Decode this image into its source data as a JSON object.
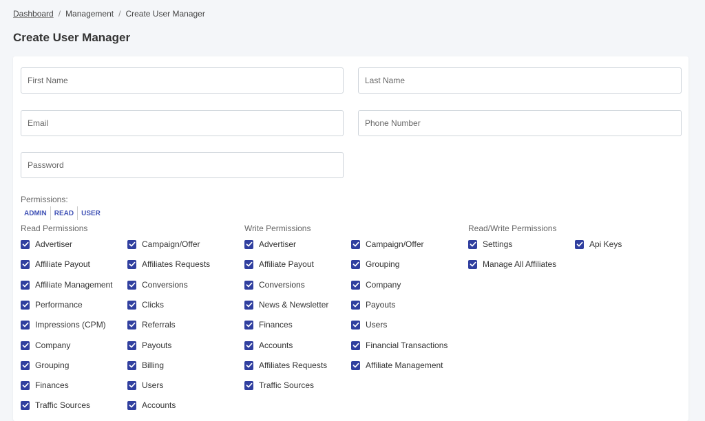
{
  "breadcrumb": {
    "items": [
      "Dashboard",
      "Management",
      "Create User Manager"
    ],
    "separator": "/"
  },
  "page_title": "Create User Manager",
  "form": {
    "first_name_placeholder": "First Name",
    "last_name_placeholder": "Last Name",
    "email_placeholder": "Email",
    "phone_placeholder": "Phone Number",
    "password_placeholder": "Password"
  },
  "permissions": {
    "label": "Permissions:",
    "roles": [
      "ADMIN",
      "READ",
      "USER"
    ],
    "accent_color": "#303f9f",
    "groups": [
      {
        "title": "Read Permissions",
        "columns": [
          [
            "Advertiser",
            "Affiliate Payout",
            "Affiliate Management",
            "Performance",
            "Impressions (CPM)",
            "Company",
            "Grouping",
            "Finances",
            "Traffic Sources"
          ],
          [
            "Campaign/Offer",
            "Affiliates Requests",
            "Conversions",
            "Clicks",
            "Referrals",
            "Payouts",
            "Billing",
            "Users",
            "Accounts"
          ]
        ]
      },
      {
        "title": "Write Permissions",
        "columns": [
          [
            "Advertiser",
            "Affiliate Payout",
            "Conversions",
            "News & Newsletter",
            "Finances",
            "Accounts",
            "Affiliates Requests",
            "Traffic Sources"
          ],
          [
            "Campaign/Offer",
            "Grouping",
            "Company",
            "Payouts",
            "Users",
            "Financial Transactions",
            "Affiliate Management"
          ]
        ]
      },
      {
        "title": "Read/Write Permissions",
        "columns": [
          [
            "Settings",
            "Manage All Affiliates"
          ],
          [
            "Api Keys"
          ]
        ]
      }
    ]
  }
}
